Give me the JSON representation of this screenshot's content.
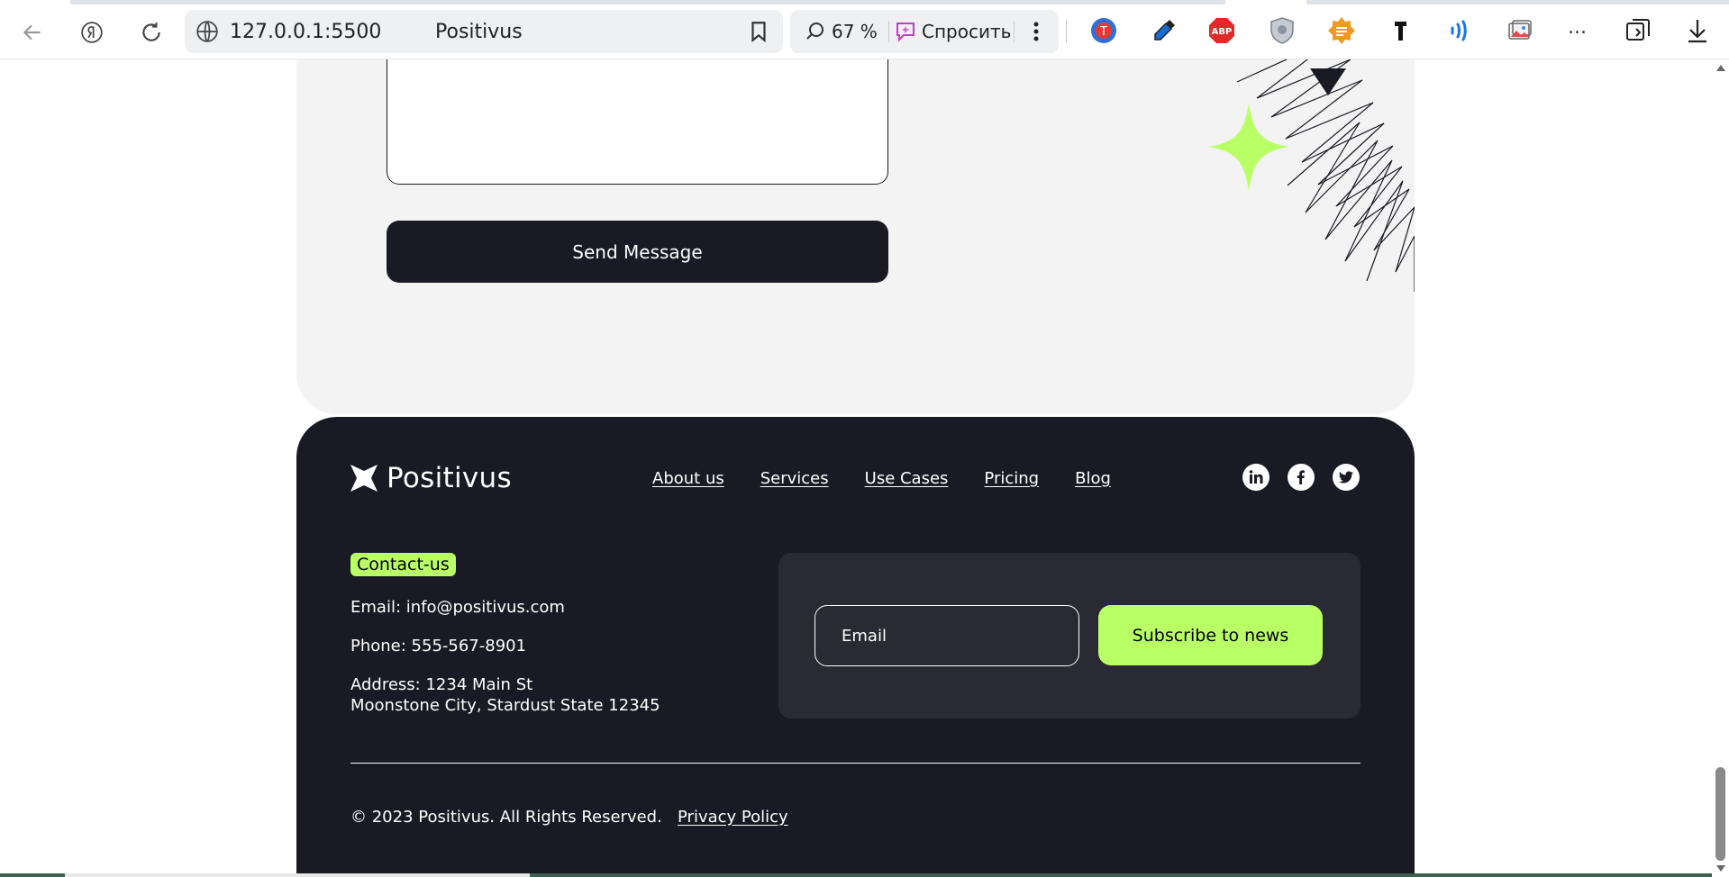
{
  "browser": {
    "url": "127.0.0.1:5500",
    "page_title": "Positivus",
    "zoom": "67 %",
    "ask_label": "Спросить",
    "more_extensions": "..."
  },
  "contact_form": {
    "send_label": "Send Message"
  },
  "footer": {
    "brand": "Positivus",
    "nav": [
      "About us",
      "Services",
      "Use Cases",
      "Pricing",
      "Blog"
    ],
    "contact_tag": "Contact-us",
    "email": "Email: info@positivus.com",
    "phone": "Phone: 555-567-8901",
    "address_line1": "Address: 1234 Main St",
    "address_line2": "Moonstone City, Stardust State 12345",
    "email_placeholder": "Email",
    "subscribe_label": "Subscribe to news",
    "copyright": "© 2023 Positivus. All Rights Reserved.",
    "privacy": "Privacy Policy",
    "social_icons": [
      "linkedin-icon",
      "facebook-icon",
      "twitter-icon"
    ]
  },
  "colors": {
    "dark": "#191a23",
    "accent": "#b9ff66",
    "card": "#f3f3f3"
  }
}
